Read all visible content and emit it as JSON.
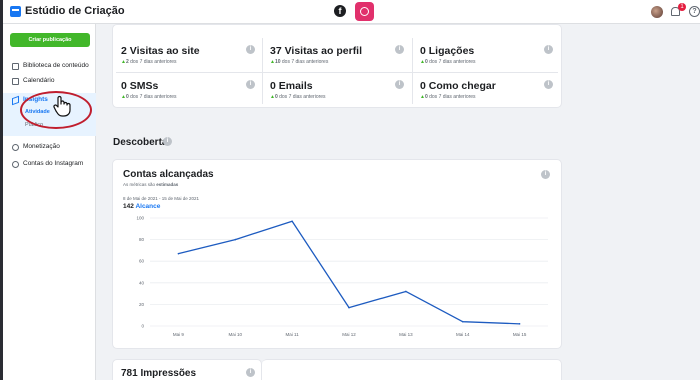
{
  "header": {
    "app_title": "Estúdio de Criação",
    "facebook_glyph": "f",
    "notification_count": "1",
    "help_glyph": "?"
  },
  "sidebar": {
    "create_button": "Criar publicação",
    "items": [
      {
        "label": "Biblioteca de conteúdo"
      },
      {
        "label": "Calendário"
      },
      {
        "label": "Insights"
      },
      {
        "label": "Monetização"
      },
      {
        "label": "Contas do Instagram"
      }
    ],
    "subitems": [
      {
        "label": "Atividade"
      },
      {
        "label": "Público"
      }
    ]
  },
  "stats": [
    {
      "title": "2 Visitas ao site",
      "delta": "2",
      "sub": " dos 7 dias anteriores"
    },
    {
      "title": "37 Visitas ao perfil",
      "delta": "10",
      "sub": " dos 7 dias anteriores"
    },
    {
      "title": "0 Ligações",
      "delta": "0",
      "sub": " dos 7 dias anteriores"
    },
    {
      "title": "0 SMSs",
      "delta": "0",
      "sub": " dos 7 dias anteriores"
    },
    {
      "title": "0 Emails",
      "delta": "0",
      "sub": " dos 7 dias anteriores"
    },
    {
      "title": "0 Como chegar",
      "delta": "0",
      "sub": " dos 7 dias anteriores"
    }
  ],
  "discovery": {
    "section_title": "Descoberta",
    "card_title": "Contas alcançadas",
    "note_prefix": "As métricas são ",
    "note_emph": "estimadas",
    "date_range": "8 de Mai de 2021 - 15 de Mai de 2021",
    "total": "142",
    "metric_label": "Alcance"
  },
  "impressions": {
    "title": "781 Impressões"
  },
  "chart_data": {
    "type": "line",
    "title": "Contas alcançadas",
    "x": [
      "Mai 9",
      "Mai 10",
      "Mai 11",
      "Mai 12",
      "Mai 13",
      "Mai 14",
      "Mai 15"
    ],
    "yticks": [
      "0",
      "20",
      "40",
      "60",
      "80",
      "100"
    ],
    "ylim": [
      0,
      100
    ],
    "series": [
      {
        "name": "Alcance",
        "values": [
          67,
          80,
          97,
          17,
          32,
          4,
          2
        ]
      }
    ],
    "line_color": "#1d5bc0",
    "grid": true
  }
}
